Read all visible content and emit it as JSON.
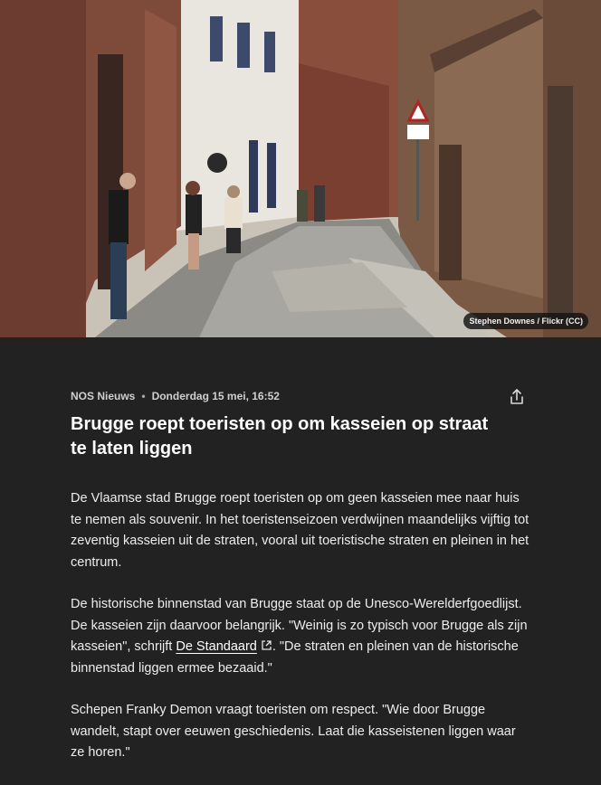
{
  "hero": {
    "credit": "Stephen Downes / Flickr (CC)"
  },
  "article": {
    "source": "NOS Nieuws",
    "separator": "•",
    "date": "Donderdag 15 mei, 16:52",
    "title": "Brugge roept toeristen op om kasseien op straat te laten liggen",
    "paragraphs": {
      "p1": "De Vlaamse stad Brugge roept toeristen op om geen kasseien mee naar huis te nemen als souvenir. In het toeristenseizoen verdwijnen maandelijks vijftig tot zeventig kasseien uit de straten, vooral uit toeristische straten en pleinen in het centrum.",
      "p2_before": "De historische binnenstad van Brugge staat op de Unesco-Werelderfgoedlijst. De kasseien zijn daarvoor belangrijk. \"Weinig is zo typisch voor Brugge als zijn kasseien\", schrijft ",
      "p2_link": "De Standaard",
      "p2_after": ". \"De straten en pleinen van de historische binnenstad liggen ermee bezaaid.\"",
      "p3": "Schepen Franky Demon vraagt toeristen om respect. \"Wie door Brugge wandelt, stapt over eeuwen geschiedenis. Laat die kasseistenen liggen waar ze horen.\""
    }
  },
  "icons": {
    "share": "share-icon",
    "external": "external-link-icon"
  },
  "colors": {
    "background": "#222222",
    "text": "#ededed",
    "title": "#ffffff"
  }
}
